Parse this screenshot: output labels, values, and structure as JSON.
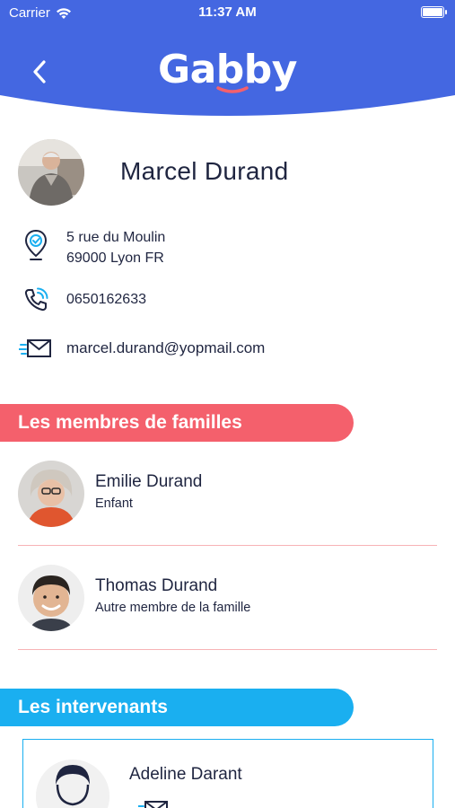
{
  "status_bar": {
    "carrier": "Carrier",
    "time": "11:37 AM"
  },
  "header": {
    "logo": "Gabby",
    "accent_color": "#4467e1"
  },
  "profile": {
    "name": "Marcel Durand",
    "address_line1": "5 rue du Moulin",
    "address_line2": "69000 Lyon FR",
    "phone": "0650162633",
    "email": "marcel.durand@yopmail.com"
  },
  "family_section": {
    "title": "Les membres de familles",
    "color": "#f4606c",
    "members": [
      {
        "name": "Emilie Durand",
        "role": "Enfant"
      },
      {
        "name": "Thomas Durand",
        "role": "Autre membre de la famille"
      }
    ]
  },
  "intervenants_section": {
    "title": "Les intervenants",
    "color": "#1aaff0",
    "items": [
      {
        "name": "Adeline Darant"
      }
    ]
  }
}
